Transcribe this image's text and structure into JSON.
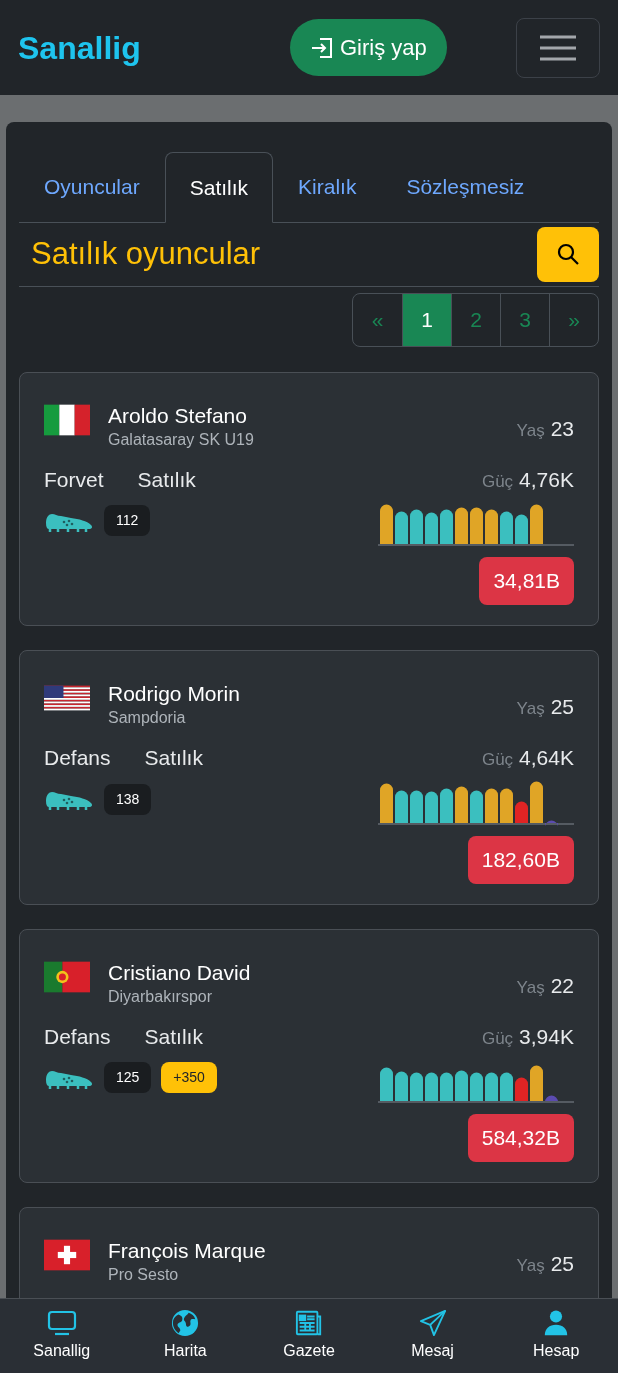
{
  "header": {
    "brand": "Sanallig",
    "login_button": "Giriş yap"
  },
  "tabs": [
    {
      "label": "Oyuncular",
      "selected": false
    },
    {
      "label": "Satılık",
      "selected": true
    },
    {
      "label": "Kiralık",
      "selected": false
    },
    {
      "label": "Sözleşmesiz",
      "selected": false
    }
  ],
  "heading": "Satılık oyuncular",
  "pagination": [
    {
      "label": "«",
      "selected": false
    },
    {
      "label": "1",
      "selected": true
    },
    {
      "label": "2",
      "selected": false
    },
    {
      "label": "3",
      "selected": false
    },
    {
      "label": "»",
      "selected": false
    }
  ],
  "players": [
    {
      "name": "Aroldo Stefano",
      "club": "Galatasaray SK U19",
      "age_label": "Yaş",
      "age": "23",
      "position": "Forvet",
      "status": "Satılık",
      "power_label": "Güç",
      "power": "4,76K",
      "badges": [
        {
          "kind": "count",
          "text": "112"
        }
      ],
      "price": "34,81B"
    },
    {
      "name": "Rodrigo Morin",
      "club": "Sampdoria",
      "age_label": "Yaş",
      "age": "25",
      "position": "Defans",
      "status": "Satılık",
      "power_label": "Güç",
      "power": "4,64K",
      "badges": [
        {
          "kind": "count",
          "text": "138"
        }
      ],
      "price": "182,60B"
    },
    {
      "name": "Cristiano David",
      "club": "Diyarbakırspor",
      "age_label": "Yaş",
      "age": "22",
      "position": "Defans",
      "status": "Satılık",
      "power_label": "Güç",
      "power": "3,94K",
      "badges": [
        {
          "kind": "count",
          "text": "125"
        },
        {
          "kind": "bonus",
          "text": "+350"
        }
      ],
      "price": "584,32B"
    },
    {
      "name": "François Marque",
      "club": "Pro Sesto",
      "age_label": "Yaş",
      "age": "25"
    }
  ],
  "bottom_nav": [
    {
      "label": "Sanallig"
    },
    {
      "label": "Harita"
    },
    {
      "label": "Gazete"
    },
    {
      "label": "Mesaj"
    },
    {
      "label": "Hesap"
    }
  ]
}
